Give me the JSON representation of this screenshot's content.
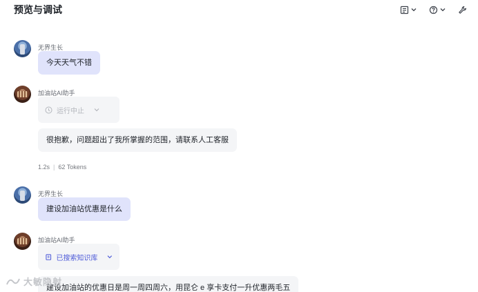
{
  "header": {
    "title": "预览与调试",
    "tools": [
      {
        "icon": "document-icon"
      },
      {
        "icon": "help-icon"
      },
      {
        "icon": "wrench-icon"
      }
    ]
  },
  "messages": [
    {
      "role": "user",
      "name": "无界生长",
      "text": "今天天气不错"
    },
    {
      "role": "bot",
      "name": "加油站AI助手",
      "status": "运行中止",
      "text": "很抱歉，问题超出了我所掌握的范围，请联系人工客服",
      "duration": "1.2s",
      "tokens": "62 Tokens"
    },
    {
      "role": "user",
      "name": "无界生长",
      "text": "建设加油站优惠是什么"
    },
    {
      "role": "bot",
      "name": "加油站AI助手",
      "status": "已搜索知识库",
      "text": "建设加油站的优惠日是周一周四周六，用昆仑 e 享卡支付一升优惠两毛五"
    }
  ],
  "watermark": "大敏隐射"
}
